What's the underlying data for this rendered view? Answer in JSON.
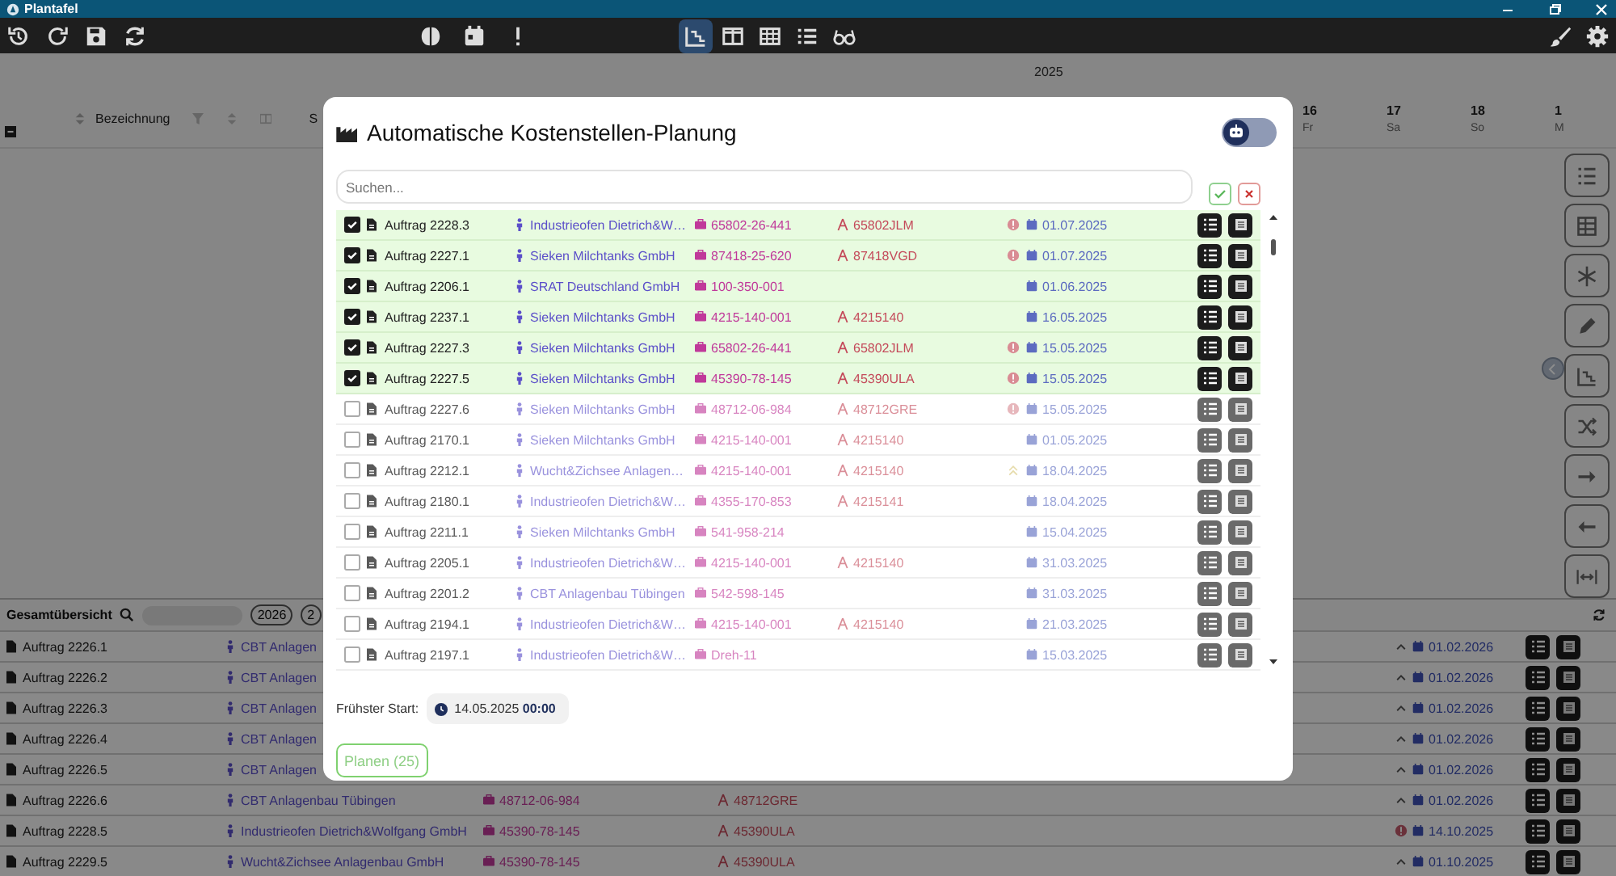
{
  "window": {
    "title": "Plantafel"
  },
  "toolbar": {
    "views": [
      {
        "kind": "chart",
        "selected": true
      },
      {
        "kind": "columns",
        "selected": false
      },
      {
        "kind": "grid",
        "selected": false
      },
      {
        "kind": "list",
        "selected": false
      },
      {
        "kind": "glasses",
        "selected": false
      }
    ]
  },
  "timeline": {
    "year": "2025",
    "first_column": "Bezeichnung",
    "second_column": "S",
    "days": [
      {
        "day": "16",
        "weekday": "Fr"
      },
      {
        "day": "17",
        "weekday": "Sa"
      },
      {
        "day": "18",
        "weekday": "So"
      },
      {
        "day": "1",
        "weekday": "M"
      }
    ]
  },
  "overview": {
    "title": "Gesamtübersicht",
    "years": [
      "2026",
      "2"
    ],
    "rows": [
      {
        "kind": "up",
        "name": "Auftrag 2226.1",
        "customer": "CBT Anlagen",
        "date": "01.02.2026"
      },
      {
        "kind": "up",
        "name": "Auftrag 2226.2",
        "customer": "CBT Anlagen",
        "date": "01.02.2026"
      },
      {
        "kind": "up",
        "name": "Auftrag 2226.3",
        "customer": "CBT Anlagen",
        "date": "01.02.2026"
      },
      {
        "kind": "up",
        "name": "Auftrag 2226.4",
        "customer": "CBT Anlagen",
        "date": "01.02.2026"
      },
      {
        "kind": "up",
        "name": "Auftrag 2226.5",
        "customer": "CBT Anlagen",
        "date": "01.02.2026"
      },
      {
        "kind": "up",
        "name": "Auftrag 2226.6",
        "customer": "CBT Anlagenbau Tübingen",
        "part": "48712-06-984",
        "drawing": "48712GRE",
        "date": "01.02.2026"
      },
      {
        "kind": "alert",
        "name": "Auftrag 2228.5",
        "customer": "Industrieofen Dietrich&Wolfgang GmbH",
        "part": "45390-78-145",
        "drawing": "45390ULA",
        "date": "14.10.2025"
      },
      {
        "kind": "up",
        "name": "Auftrag 2229.5",
        "customer": "Wucht&Zichsee Anlagenbau GmbH",
        "part": "45390-78-145",
        "drawing": "45390ULA",
        "date": "01.10.2025"
      }
    ]
  },
  "dialog": {
    "title": "Automatische Kostenstellen-Planung",
    "toggle": {
      "on": false
    },
    "search": {
      "placeholder": "Suchen..."
    },
    "rows": [
      {
        "kind": "alert",
        "checked": true,
        "name": "Auftrag 2228.3",
        "customer": "Industrieofen Dietrich&W…",
        "part": "65802-26-441",
        "drawing": "65802JLM",
        "date": "01.07.2025"
      },
      {
        "kind": "alert",
        "checked": true,
        "name": "Auftrag 2227.1",
        "customer": "Sieken Milchtanks GmbH",
        "part": "87418-25-620",
        "drawing": "87418VGD",
        "date": "01.07.2025"
      },
      {
        "kind": "plain",
        "checked": true,
        "name": "Auftrag 2206.1",
        "customer": "SRAT Deutschland GmbH",
        "part": "100-350-001",
        "date": "01.06.2025"
      },
      {
        "kind": "plain",
        "checked": true,
        "name": "Auftrag 2237.1",
        "customer": "Sieken Milchtanks GmbH",
        "part": "4215-140-001",
        "drawing": "4215140",
        "date": "16.05.2025"
      },
      {
        "kind": "alert",
        "checked": true,
        "name": "Auftrag 2227.3",
        "customer": "Sieken Milchtanks GmbH",
        "part": "65802-26-441",
        "drawing": "65802JLM",
        "date": "15.05.2025"
      },
      {
        "kind": "alert",
        "checked": true,
        "name": "Auftrag 2227.5",
        "customer": "Sieken Milchtanks GmbH",
        "part": "45390-78-145",
        "drawing": "45390ULA",
        "date": "15.05.2025"
      },
      {
        "kind": "alert",
        "checked": false,
        "name": "Auftrag 2227.6",
        "customer": "Sieken Milchtanks GmbH",
        "part": "48712-06-984",
        "drawing": "48712GRE",
        "date": "15.05.2025"
      },
      {
        "kind": "plain",
        "checked": false,
        "name": "Auftrag 2170.1",
        "customer": "Sieken Milchtanks GmbH",
        "part": "4215-140-001",
        "drawing": "4215140",
        "date": "01.05.2025"
      },
      {
        "kind": "priority",
        "checked": false,
        "name": "Auftrag 2212.1",
        "customer": "Wucht&Zichsee Anlagen…",
        "part": "4215-140-001",
        "drawing": "4215140",
        "date": "18.04.2025"
      },
      {
        "kind": "plain",
        "checked": false,
        "name": "Auftrag 2180.1",
        "customer": "Industrieofen Dietrich&W…",
        "part": "4355-170-853",
        "drawing": "4215141",
        "date": "18.04.2025"
      },
      {
        "kind": "plain",
        "checked": false,
        "name": "Auftrag 2211.1",
        "customer": "Sieken Milchtanks GmbH",
        "part": "541-958-214",
        "date": "15.04.2025"
      },
      {
        "kind": "plain",
        "checked": false,
        "name": "Auftrag 2205.1",
        "customer": "Industrieofen Dietrich&W…",
        "part": "4215-140-001",
        "drawing": "4215140",
        "date": "31.03.2025"
      },
      {
        "kind": "plain",
        "checked": false,
        "name": "Auftrag 2201.2",
        "customer": "CBT Anlagenbau Tübingen",
        "part": "542-598-145",
        "date": "31.03.2025"
      },
      {
        "kind": "plain",
        "checked": false,
        "name": "Auftrag 2194.1",
        "customer": "Industrieofen Dietrich&W…",
        "part": "4215-140-001",
        "drawing": "4215140",
        "date": "21.03.2025"
      },
      {
        "kind": "plain",
        "checked": false,
        "name": "Auftrag 2197.1",
        "customer": "Industrieofen Dietrich&W…",
        "part": "Dreh-11",
        "date": "15.03.2025"
      }
    ],
    "start_label": "Frühster Start:",
    "start_value": "14.05.2025 **00:00**",
    "plan_button": "Planen (25)"
  }
}
